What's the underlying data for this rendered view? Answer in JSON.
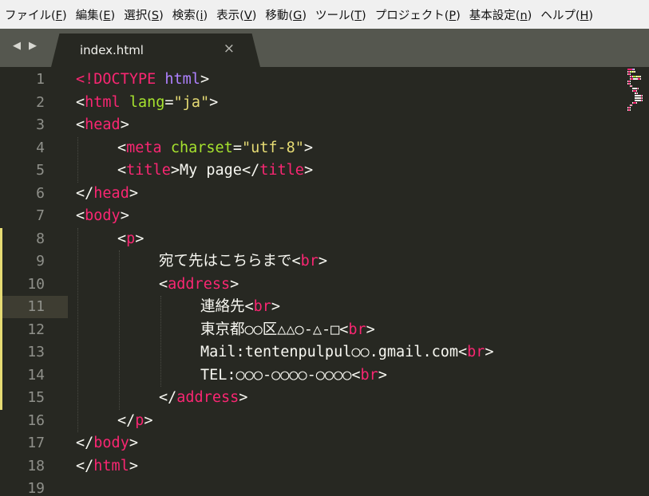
{
  "menu": [
    {
      "label": "ファイル(",
      "mnemonic": "F",
      "close": ")"
    },
    {
      "label": "編集(",
      "mnemonic": "E",
      "close": ")"
    },
    {
      "label": "選択(",
      "mnemonic": "S",
      "close": ")"
    },
    {
      "label": "検索(",
      "mnemonic": "i",
      "close": ")"
    },
    {
      "label": "表示(",
      "mnemonic": "V",
      "close": ")"
    },
    {
      "label": "移動(",
      "mnemonic": "G",
      "close": ")"
    },
    {
      "label": "ツール(",
      "mnemonic": "T",
      "close": ")"
    },
    {
      "label": "プロジェクト(",
      "mnemonic": "P",
      "close": ")"
    },
    {
      "label": "基本設定(",
      "mnemonic": "n",
      "close": ")"
    },
    {
      "label": "ヘルプ(",
      "mnemonic": "H",
      "close": ")"
    }
  ],
  "tab": {
    "title": "index.html",
    "close": "×"
  },
  "nav": {
    "back": "◀",
    "forward": "▶"
  },
  "editor": {
    "current_line": 11,
    "modified_lines": [
      8,
      15
    ],
    "colors": {
      "tag": "#f92672",
      "attr": "#a6e22e",
      "string": "#e6db74",
      "keyword": "#ae81ff",
      "text": "#f8f8f2"
    },
    "lines": [
      {
        "n": "1",
        "indent": 0,
        "tokens": [
          [
            "tag",
            "<!DOCTYPE "
          ],
          [
            "doctype-kw",
            "html"
          ],
          [
            "txt",
            ">"
          ]
        ]
      },
      {
        "n": "2",
        "indent": 0,
        "tokens": [
          [
            "txt",
            "<"
          ],
          [
            "tag",
            "html"
          ],
          [
            "txt",
            " "
          ],
          [
            "attr",
            "lang"
          ],
          [
            "txt",
            "="
          ],
          [
            "str",
            "\"ja\""
          ],
          [
            "txt",
            ">"
          ]
        ]
      },
      {
        "n": "3",
        "indent": 0,
        "tokens": [
          [
            "txt",
            "<"
          ],
          [
            "tag",
            "head"
          ],
          [
            "txt",
            ">"
          ]
        ]
      },
      {
        "n": "4",
        "indent": 1,
        "tokens": [
          [
            "txt",
            "<"
          ],
          [
            "tag",
            "meta"
          ],
          [
            "txt",
            " "
          ],
          [
            "attr",
            "charset"
          ],
          [
            "txt",
            "="
          ],
          [
            "str",
            "\"utf-8\""
          ],
          [
            "txt",
            ">"
          ]
        ]
      },
      {
        "n": "5",
        "indent": 1,
        "tokens": [
          [
            "txt",
            "<"
          ],
          [
            "tag",
            "title"
          ],
          [
            "txt",
            ">My page</"
          ],
          [
            "tag",
            "title"
          ],
          [
            "txt",
            ">"
          ]
        ]
      },
      {
        "n": "6",
        "indent": 0,
        "tokens": [
          [
            "txt",
            "</"
          ],
          [
            "tag",
            "head"
          ],
          [
            "txt",
            ">"
          ]
        ]
      },
      {
        "n": "7",
        "indent": 0,
        "tokens": [
          [
            "txt",
            "<"
          ],
          [
            "tag",
            "body"
          ],
          [
            "txt",
            ">"
          ]
        ]
      },
      {
        "n": "8",
        "indent": 1,
        "tokens": [
          [
            "txt",
            "<"
          ],
          [
            "tag",
            "p"
          ],
          [
            "txt",
            ">"
          ]
        ]
      },
      {
        "n": "9",
        "indent": 2,
        "tokens": [
          [
            "txt",
            "宛て先はこちらまで<"
          ],
          [
            "tag",
            "br"
          ],
          [
            "txt",
            ">"
          ]
        ]
      },
      {
        "n": "10",
        "indent": 2,
        "tokens": [
          [
            "txt",
            "<"
          ],
          [
            "tag",
            "address"
          ],
          [
            "txt",
            ">"
          ]
        ]
      },
      {
        "n": "11",
        "indent": 3,
        "tokens": [
          [
            "txt",
            "連絡先<"
          ],
          [
            "tag",
            "br"
          ],
          [
            "txt",
            ">"
          ]
        ]
      },
      {
        "n": "12",
        "indent": 3,
        "tokens": [
          [
            "txt",
            "東京都○○区△△○-△-□<"
          ],
          [
            "tag",
            "br"
          ],
          [
            "txt",
            ">"
          ]
        ]
      },
      {
        "n": "13",
        "indent": 3,
        "tokens": [
          [
            "txt",
            "Mail:tentenpulpul○○.gmail.com<"
          ],
          [
            "tag",
            "br"
          ],
          [
            "txt",
            ">"
          ]
        ]
      },
      {
        "n": "14",
        "indent": 3,
        "tokens": [
          [
            "txt",
            "TEL:○○○-○○○○-○○○○<"
          ],
          [
            "tag",
            "br"
          ],
          [
            "txt",
            ">"
          ]
        ]
      },
      {
        "n": "15",
        "indent": 2,
        "tokens": [
          [
            "txt",
            "</"
          ],
          [
            "tag",
            "address"
          ],
          [
            "txt",
            ">"
          ]
        ]
      },
      {
        "n": "16",
        "indent": 1,
        "tokens": [
          [
            "txt",
            "</"
          ],
          [
            "tag",
            "p"
          ],
          [
            "txt",
            ">"
          ]
        ]
      },
      {
        "n": "17",
        "indent": 0,
        "tokens": [
          [
            "txt",
            "</"
          ],
          [
            "tag",
            "body"
          ],
          [
            "txt",
            ">"
          ]
        ]
      },
      {
        "n": "18",
        "indent": 0,
        "tokens": [
          [
            "txt",
            "</"
          ],
          [
            "tag",
            "html"
          ],
          [
            "txt",
            ">"
          ]
        ]
      },
      {
        "n": "19",
        "indent": 0,
        "tokens": []
      }
    ]
  }
}
